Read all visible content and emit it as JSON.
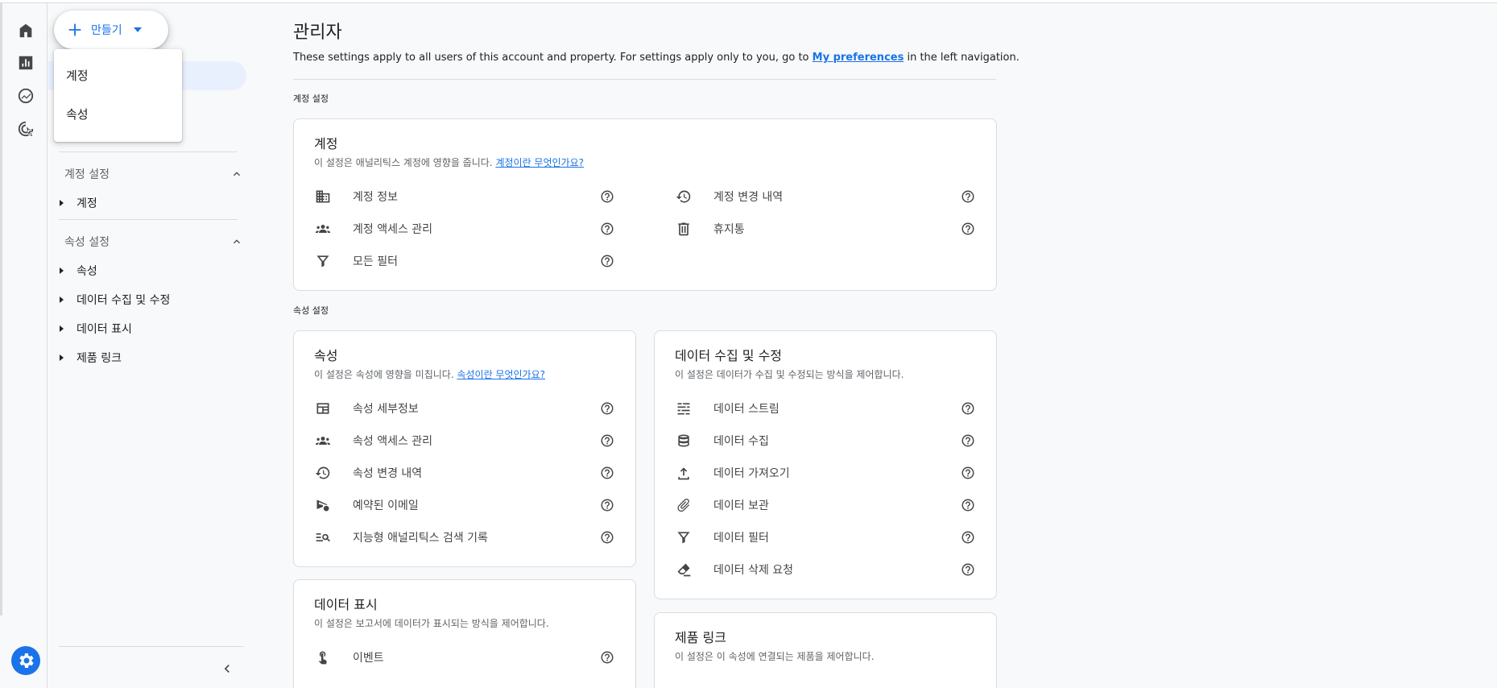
{
  "rail": {
    "items": [
      {
        "icon": "home-icon"
      },
      {
        "icon": "reports-icon"
      },
      {
        "icon": "explore-icon"
      },
      {
        "icon": "advertising-icon"
      }
    ],
    "settings_icon": "gear-icon"
  },
  "nav": {
    "create_label": "만들기",
    "menu": [
      "계정",
      "속성"
    ],
    "account_section": "계정 설정",
    "account_items": [
      "계정"
    ],
    "property_section": "속성 설정",
    "property_items": [
      "속성",
      "데이터 수집 및 수정",
      "데이터 표시",
      "제품 링크"
    ]
  },
  "main": {
    "title": "관리자",
    "desc_before": "These settings apply to all users of this account and property. For settings apply only to you, go to ",
    "desc_link": "My preferences",
    "desc_after": " in the left navigation.",
    "account_settings_label": "계정 설정",
    "property_settings_label": "속성 설정"
  },
  "account_card": {
    "title": "계정",
    "desc": "이 설정은 애널리틱스 계정에 영향을 줍니다. ",
    "desc_link": "계정이란 무엇인가요?",
    "left": [
      {
        "label": "계정 정보",
        "icon": "building-icon"
      },
      {
        "label": "계정 액세스 관리",
        "icon": "people-icon"
      },
      {
        "label": "모든 필터",
        "icon": "filter-icon"
      }
    ],
    "right": [
      {
        "label": "계정 변경 내역",
        "icon": "history-icon"
      },
      {
        "label": "휴지통",
        "icon": "trash-icon"
      }
    ]
  },
  "property_card": {
    "title": "속성",
    "desc": "이 설정은 속성에 영향을 미칩니다. ",
    "desc_link": "속성이란 무엇인가요?",
    "items": [
      {
        "label": "속성 세부정보",
        "icon": "property-details-icon"
      },
      {
        "label": "속성 액세스 관리",
        "icon": "people-icon"
      },
      {
        "label": "속성 변경 내역",
        "icon": "history-icon"
      },
      {
        "label": "예약된 이메일",
        "icon": "scheduled-email-icon"
      },
      {
        "label": "지능형 애널리틱스 검색 기록",
        "icon": "search-history-icon"
      }
    ]
  },
  "data_collection_card": {
    "title": "데이터 수집 및 수정",
    "desc": "이 설정은 데이터가 수집 및 수정되는 방식을 제어합니다.",
    "items": [
      {
        "label": "데이터 스트림",
        "icon": "data-stream-icon"
      },
      {
        "label": "데이터 수집",
        "icon": "database-icon"
      },
      {
        "label": "데이터 가져오기",
        "icon": "upload-icon"
      },
      {
        "label": "데이터 보관",
        "icon": "attachment-icon"
      },
      {
        "label": "데이터 필터",
        "icon": "filter-icon"
      },
      {
        "label": "데이터 삭제 요청",
        "icon": "eraser-icon"
      }
    ]
  },
  "data_display_card": {
    "title": "데이터 표시",
    "desc": "이 설정은 보고서에 데이터가 표시되는 방식을 제어합니다.",
    "items": [
      {
        "label": "이벤트",
        "icon": "touch-icon"
      }
    ]
  },
  "product_links_card": {
    "title": "제품 링크",
    "desc": "이 설정은 이 속성에 연결되는 제품을 제어합니다."
  },
  "colors": {
    "accent": "#1a73e8",
    "selected_bg": "#e8f0fe",
    "border": "#dadce0"
  }
}
